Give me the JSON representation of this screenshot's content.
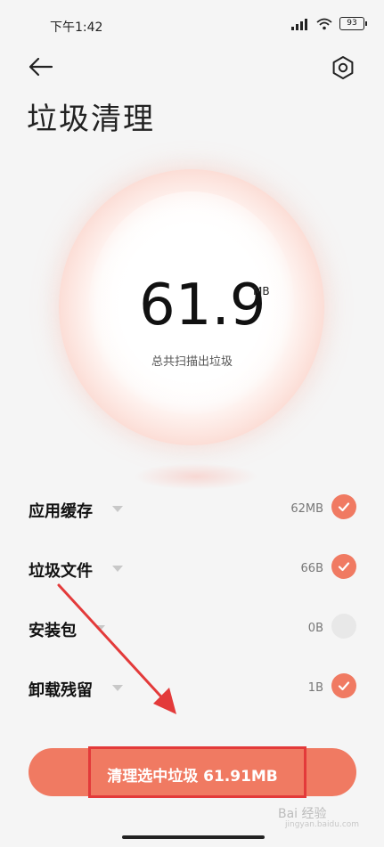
{
  "status": {
    "time": "下午1:42",
    "battery": "93"
  },
  "header": {
    "title": "垃圾清理"
  },
  "summary": {
    "amount": "61.9",
    "unit": "MB",
    "caption": "总共扫描出垃圾"
  },
  "items": [
    {
      "label": "应用缓存",
      "size": "62MB",
      "checked": true
    },
    {
      "label": "垃圾文件",
      "size": "66B",
      "checked": true
    },
    {
      "label": "安装包",
      "size": "0B",
      "checked": false
    },
    {
      "label": "卸载残留",
      "size": "1B",
      "checked": true
    }
  ],
  "action": {
    "label": "清理选中垃圾 61.91MB"
  },
  "watermark": {
    "text": "Bai 经验",
    "sub": "jingyan.baidu.com"
  },
  "colors": {
    "accent": "#f07a62",
    "annotation": "#e33a3a"
  }
}
